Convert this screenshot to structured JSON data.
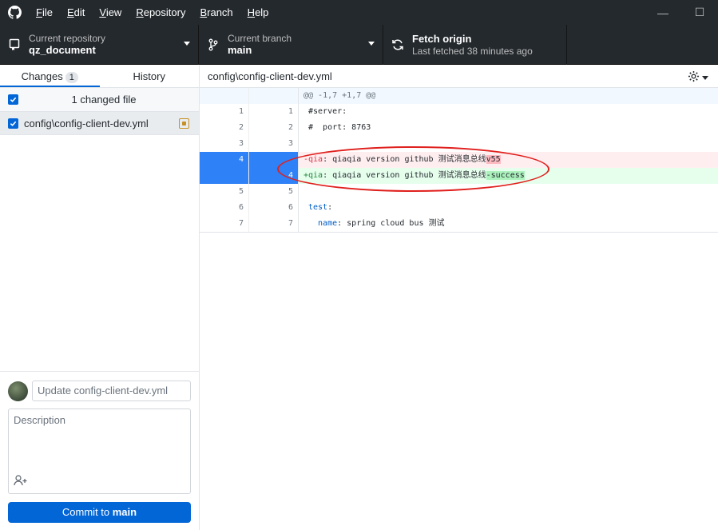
{
  "menu": [
    "File",
    "Edit",
    "View",
    "Repository",
    "Branch",
    "Help"
  ],
  "menu_mnemonics": [
    "F",
    "E",
    "V",
    "R",
    "B",
    "H"
  ],
  "toolbar": {
    "repo_label": "Current repository",
    "repo_name": "qz_document",
    "branch_label": "Current branch",
    "branch_name": "main",
    "fetch_title": "Fetch origin",
    "fetch_sub": "Last fetched 38 minutes ago"
  },
  "tabs": {
    "changes": "Changes",
    "changes_count": "1",
    "history": "History"
  },
  "changes_header": "1 changed file",
  "file": {
    "name": "config\\config-client-dev.yml"
  },
  "commit": {
    "summary_placeholder": "Update config-client-dev.yml",
    "description_placeholder": "Description",
    "button_prefix": "Commit to ",
    "button_branch": "main"
  },
  "diff": {
    "path": "config\\config-client-dev.yml",
    "hunk": "@@ -1,7 +1,7 @@",
    "lines": [
      {
        "old": "1",
        "new": "1",
        "type": "ctx",
        "text": "#server:"
      },
      {
        "old": "2",
        "new": "2",
        "type": "ctx",
        "text": "#  port: 8763"
      },
      {
        "old": "3",
        "new": "3",
        "type": "ctx",
        "text": ""
      },
      {
        "old": "4",
        "new": "",
        "type": "del",
        "prefix": "-",
        "key": "qia",
        "text": ": qiaqia version github 测试消息总线",
        "hl": "v55"
      },
      {
        "old": "",
        "new": "4",
        "type": "add",
        "prefix": "+",
        "key": "qia",
        "text": ": qiaqia version github 测试消息总线",
        "hl": "-success"
      },
      {
        "old": "5",
        "new": "5",
        "type": "ctx",
        "text": ""
      },
      {
        "old": "6",
        "new": "6",
        "type": "ctx",
        "key": "test",
        "text": ":"
      },
      {
        "old": "7",
        "new": "7",
        "type": "ctx",
        "key": "  name",
        "text": ": spring cloud bus 测试"
      }
    ]
  },
  "colors": {
    "accent": "#0366d6",
    "annotation": "#e0201d"
  }
}
